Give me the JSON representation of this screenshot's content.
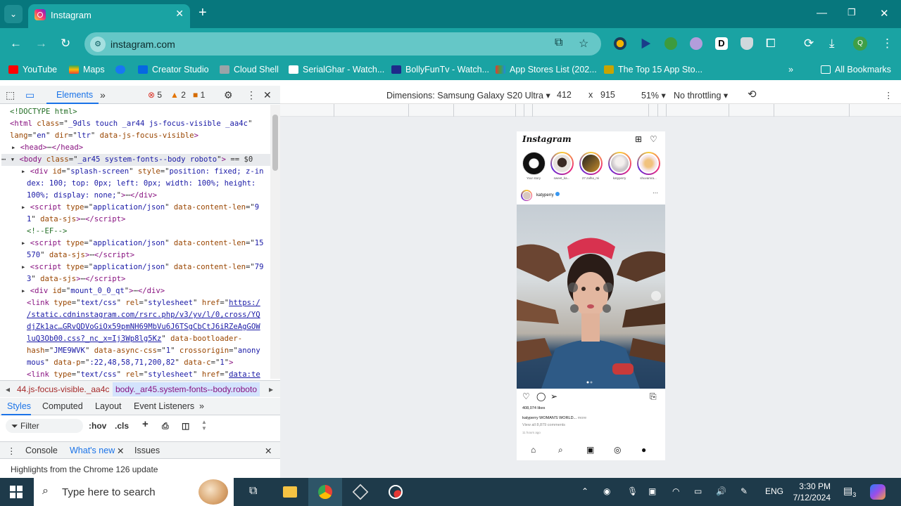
{
  "browser": {
    "tab_title": "Instagram",
    "url": "instagram.com",
    "bookmarks": [
      "YouTube",
      "Maps",
      "Creator Studio",
      "Cloud Shell",
      "SerialGhar - Watch...",
      "BollyFunTv - Watch...",
      "App Stores List (202...",
      "The Top 15 App Sto..."
    ],
    "all_bookmarks": "All Bookmarks",
    "profile_letter": "Q",
    "accent": "#1aa3a3"
  },
  "devtools": {
    "elements_tab": "Elements",
    "errors": "5",
    "warnings": "2",
    "infos": "1",
    "breadcrumbs": [
      "44.js-focus-visible._aa4c",
      "body._ar45.system-fonts--body.roboto"
    ],
    "styles_tabs": [
      "Styles",
      "Computed",
      "Layout",
      "Event Listeners"
    ],
    "filter_placeholder": "Filter",
    "hov": ":hov",
    "cls": ".cls",
    "drawer_tabs": [
      "Console",
      "What's new",
      "Issues"
    ],
    "drawer_message": "Highlights from the Chrome 126 update"
  },
  "device_toolbar": {
    "dimensions": "Dimensions: Samsung Galaxy S20 Ultra",
    "width": "412",
    "x": "x",
    "height": "915",
    "zoom": "51%",
    "throttling": "No throttling"
  },
  "instagram": {
    "logo": "Instagram",
    "stories": [
      "Your story",
      "sweet_ka...",
      "27.zalha_mi",
      "katyperry",
      "shuvamra..."
    ],
    "post_user": "katyperry",
    "likes": "408,074 likes",
    "caption_user": "katyperry",
    "caption_text": "WOMAN'S WORLD...",
    "caption_more": "more",
    "comments": "View all 8,879 comments",
    "time": "11 hours ago"
  },
  "taskbar": {
    "search_placeholder": "Type here to search",
    "language": "ENG",
    "time": "3:30 PM",
    "date": "7/12/2024",
    "notifications": "3"
  }
}
